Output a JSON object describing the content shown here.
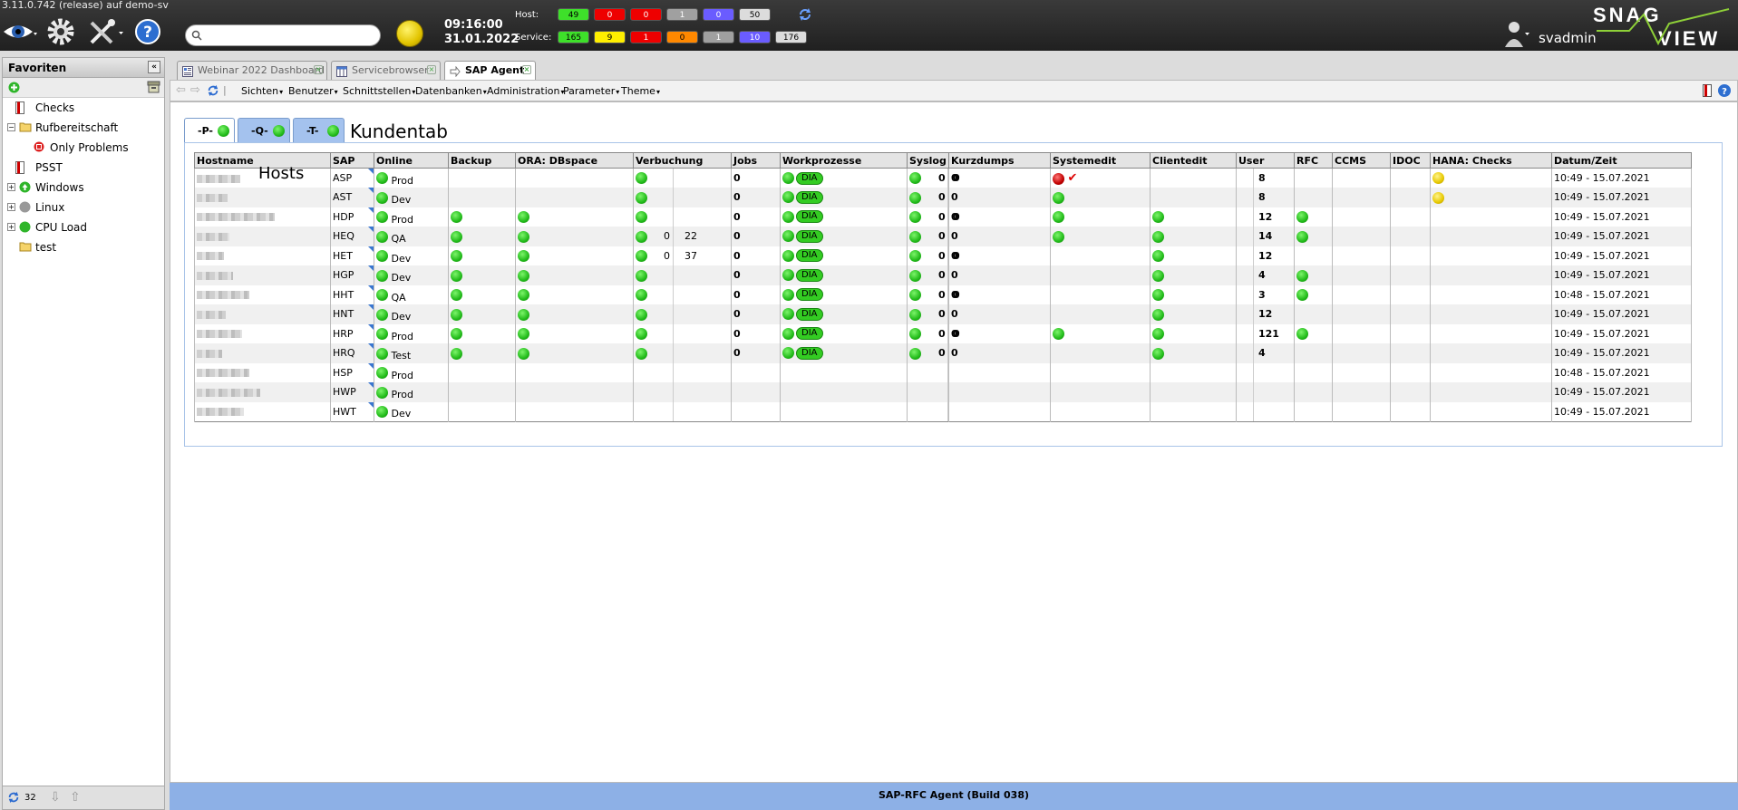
{
  "app": {
    "version": "3.11.0.742 (release) auf demo-sv",
    "time": "09:16:00",
    "date": "31.01.2022",
    "username": "svadmin"
  },
  "counters": {
    "host_label": "Host:",
    "service_label": "Service:",
    "host": [
      {
        "v": "49",
        "c": "#3ee02a"
      },
      {
        "v": "0",
        "c": "#ee0000"
      },
      {
        "v": "0",
        "c": "#ee0000"
      },
      {
        "v": "1",
        "c": "#a0a0a0"
      },
      {
        "v": "0",
        "c": "#6a5cff"
      },
      {
        "v": "50",
        "c": "#dcdcdc"
      }
    ],
    "service": [
      {
        "v": "165",
        "c": "#3ee02a"
      },
      {
        "v": "9",
        "c": "#ffee00"
      },
      {
        "v": "1",
        "c": "#ee0000"
      },
      {
        "v": "0",
        "c": "#ff8800"
      },
      {
        "v": "1",
        "c": "#a0a0a0"
      },
      {
        "v": "10",
        "c": "#6a5cff"
      },
      {
        "v": "176",
        "c": "#dcdcdc"
      }
    ]
  },
  "sidebar": {
    "title": "Favoriten",
    "items": [
      {
        "label": "Checks",
        "icon": "checks-icon"
      },
      {
        "label": "Rufbereitschaft",
        "icon": "folder-icon"
      },
      {
        "label": "Only Problems",
        "icon": "problems-icon"
      },
      {
        "label": "PSST",
        "icon": "checks-icon"
      },
      {
        "label": "Windows",
        "icon": "windows-status-icon"
      },
      {
        "label": "Linux",
        "icon": "linux-status-icon"
      },
      {
        "label": "CPU Load",
        "icon": "cpu-status-icon"
      },
      {
        "label": "test",
        "icon": "folder-icon"
      }
    ],
    "footer_count": "32"
  },
  "tabs": [
    {
      "label": "Webinar 2022 Dashboard"
    },
    {
      "label": "Servicebrowser"
    },
    {
      "label": "SAP Agent"
    }
  ],
  "menu": [
    "Sichten",
    "Benutzer",
    "Schnittstellen",
    "Datenbanken",
    "Administration",
    "Parameter",
    "Theme"
  ],
  "subtabs": [
    "-P-",
    "-Q-",
    "-T-"
  ],
  "kundentab": "Kundentab",
  "hosts_overlay": "Hosts",
  "table": {
    "headers": [
      "Hostname",
      "SAP",
      "Online",
      "Backup",
      "ORA: DBspace",
      "Verbuchung",
      "Jobs",
      "Workprozesse",
      "Syslog",
      "Kurzdumps",
      "Systemedit",
      "Clientedit",
      "User",
      "RFC",
      "CCMS",
      "IDOC",
      "HANA: Checks",
      "Datum/Zeit"
    ],
    "dia_label": "DIA",
    "rows": [
      {
        "sid": "ASP",
        "env": "Prod",
        "backup": false,
        "ora": false,
        "verb": true,
        "v1": "",
        "v2": "",
        "jobs": "0",
        "wp": true,
        "sys": true,
        "s1": "0",
        "s2": "0",
        "kd": "0",
        "sysedit": "red",
        "ce": false,
        "user": "8",
        "rfc": false,
        "hana": true,
        "dt": "10:49 - 15.07.2021"
      },
      {
        "sid": "AST",
        "env": "Dev",
        "backup": false,
        "ora": false,
        "verb": true,
        "v1": "",
        "v2": "",
        "jobs": "0",
        "wp": true,
        "sys": true,
        "s1": "0",
        "s2": "0",
        "kd": "0",
        "sysedit": "green",
        "ce": false,
        "user": "8",
        "rfc": false,
        "hana": true,
        "dt": "10:49 - 15.07.2021"
      },
      {
        "sid": "HDP",
        "env": "Prod",
        "backup": true,
        "ora": true,
        "verb": true,
        "v1": "",
        "v2": "",
        "jobs": "0",
        "wp": true,
        "sys": true,
        "s1": "0",
        "s2": "0",
        "kd": "0",
        "sysedit": "green",
        "ce": true,
        "user": "12",
        "rfc": true,
        "hana": false,
        "dt": "10:49 - 15.07.2021"
      },
      {
        "sid": "HEQ",
        "env": "QA",
        "backup": true,
        "ora": true,
        "verb": true,
        "v1": "0",
        "v2": "22",
        "jobs": "0",
        "wp": true,
        "sys": true,
        "s1": "0",
        "s2": "0",
        "kd": "0",
        "sysedit": "green",
        "ce": true,
        "user": "14",
        "rfc": true,
        "hana": false,
        "dt": "10:49 - 15.07.2021"
      },
      {
        "sid": "HET",
        "env": "Dev",
        "backup": true,
        "ora": true,
        "verb": true,
        "v1": "0",
        "v2": "37",
        "jobs": "0",
        "wp": true,
        "sys": true,
        "s1": "0",
        "s2": "0",
        "kd": "0",
        "sysedit": "",
        "ce": true,
        "user": "12",
        "rfc": false,
        "hana": false,
        "dt": "10:49 - 15.07.2021"
      },
      {
        "sid": "HGP",
        "env": "Dev",
        "backup": true,
        "ora": true,
        "verb": true,
        "v1": "",
        "v2": "",
        "jobs": "0",
        "wp": true,
        "sys": true,
        "s1": "0",
        "s2": "0",
        "kd": "0",
        "sysedit": "",
        "ce": true,
        "user": "4",
        "rfc": true,
        "hana": false,
        "dt": "10:49 - 15.07.2021"
      },
      {
        "sid": "HHT",
        "env": "QA",
        "backup": true,
        "ora": true,
        "verb": true,
        "v1": "",
        "v2": "",
        "jobs": "0",
        "wp": true,
        "sys": true,
        "s1": "0",
        "s2": "0",
        "kd": "0",
        "sysedit": "",
        "ce": true,
        "user": "3",
        "rfc": true,
        "hana": false,
        "dt": "10:48 - 15.07.2021"
      },
      {
        "sid": "HNT",
        "env": "Dev",
        "backup": true,
        "ora": true,
        "verb": true,
        "v1": "",
        "v2": "",
        "jobs": "0",
        "wp": true,
        "sys": true,
        "s1": "0",
        "s2": "0",
        "kd": "0",
        "sysedit": "",
        "ce": true,
        "user": "12",
        "rfc": false,
        "hana": false,
        "dt": "10:49 - 15.07.2021"
      },
      {
        "sid": "HRP",
        "env": "Prod",
        "backup": true,
        "ora": true,
        "verb": true,
        "v1": "",
        "v2": "",
        "jobs": "0",
        "wp": true,
        "sys": true,
        "s1": "0",
        "s2": "0",
        "kd": "0",
        "sysedit": "green",
        "ce": true,
        "user": "121",
        "rfc": true,
        "hana": false,
        "dt": "10:49 - 15.07.2021"
      },
      {
        "sid": "HRQ",
        "env": "Test",
        "backup": true,
        "ora": true,
        "verb": true,
        "v1": "",
        "v2": "",
        "jobs": "0",
        "wp": true,
        "sys": true,
        "s1": "0",
        "s2": "0",
        "kd": "0",
        "sysedit": "",
        "ce": true,
        "user": "4",
        "rfc": false,
        "hana": false,
        "dt": "10:49 - 15.07.2021"
      },
      {
        "sid": "HSP",
        "env": "Prod",
        "backup": false,
        "ora": false,
        "verb": false,
        "v1": "",
        "v2": "",
        "jobs": "",
        "wp": false,
        "sys": false,
        "s1": "",
        "s2": "",
        "kd": "",
        "sysedit": "",
        "ce": false,
        "user": "",
        "rfc": false,
        "hana": false,
        "dt": "10:48 - 15.07.2021"
      },
      {
        "sid": "HWP",
        "env": "Prod",
        "backup": false,
        "ora": false,
        "verb": false,
        "v1": "",
        "v2": "",
        "jobs": "",
        "wp": false,
        "sys": false,
        "s1": "",
        "s2": "",
        "kd": "",
        "sysedit": "",
        "ce": false,
        "user": "",
        "rfc": false,
        "hana": false,
        "dt": "10:49 - 15.07.2021"
      },
      {
        "sid": "HWT",
        "env": "Dev",
        "backup": false,
        "ora": false,
        "verb": false,
        "v1": "",
        "v2": "",
        "jobs": "",
        "wp": false,
        "sys": false,
        "s1": "",
        "s2": "",
        "kd": "",
        "sysedit": "",
        "ce": false,
        "user": "",
        "rfc": false,
        "hana": false,
        "dt": "10:49 - 15.07.2021"
      }
    ]
  },
  "footer": "SAP-RFC Agent (Build 038)"
}
